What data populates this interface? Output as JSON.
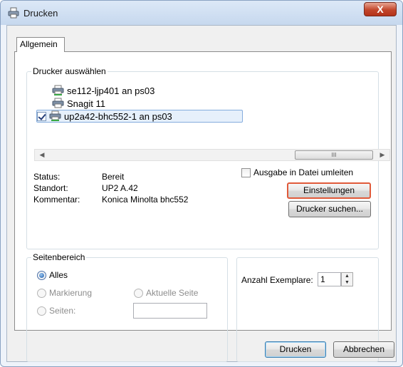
{
  "window": {
    "title": "Drucken",
    "close_label": "X"
  },
  "tabs": [
    {
      "label": "Allgemein",
      "active": true
    }
  ],
  "printer_group": {
    "title": "Drucker auswählen",
    "printers": [
      {
        "name": "se112-ljp401 an ps03",
        "selected": false
      },
      {
        "name": "Snagit 11",
        "selected": false
      },
      {
        "name": "up2a42-bhc552-1 an ps03",
        "selected": true
      }
    ],
    "scroll_thumb_glyph": "III"
  },
  "info": {
    "status_label": "Status:",
    "status_value": "Bereit",
    "location_label": "Standort:",
    "location_value": "UP2 A.42",
    "comment_label": "Kommentar:",
    "comment_value": "Konica Minolta bhc552",
    "print_to_file_label": "Ausgabe in Datei umleiten",
    "settings_button": "Einstellungen",
    "find_printer_button": "Drucker suchen..."
  },
  "page_range": {
    "title": "Seitenbereich",
    "all_label": "Alles",
    "selection_label": "Markierung",
    "current_page_label": "Aktuelle Seite",
    "pages_label": "Seiten:",
    "pages_value": ""
  },
  "copies": {
    "label": "Anzahl Exemplare:",
    "value": "1"
  },
  "footer": {
    "print_button": "Drucken",
    "cancel_button": "Abbrechen"
  },
  "colors": {
    "focus_border": "#e05a3a",
    "selection_bg": "#e6f0fb",
    "close_button": "#c2462b"
  }
}
